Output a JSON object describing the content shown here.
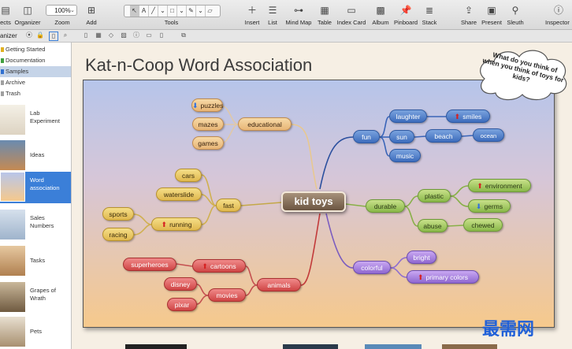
{
  "toolbar": {
    "left_cut_label": "ects",
    "organizer_label": "Organizer",
    "zoom_value": "100%",
    "zoom_label": "Zoom",
    "add_label": "Add",
    "tools_label": "Tools",
    "insert_label": "Insert",
    "list_label": "List",
    "mindmap_label": "Mind Map",
    "table_label": "Table",
    "indexcard_label": "Index Card",
    "album_label": "Album",
    "pinboard_label": "Pinboard",
    "stack_label": "Stack",
    "share_label": "Share",
    "present_label": "Present",
    "sleuth_label": "Sleuth",
    "inspector_label": "Inspector"
  },
  "subbar": {
    "organizer_tab": "anizer"
  },
  "sidebar": {
    "categories": [
      {
        "label": "Getting Started",
        "color": "#e0b020"
      },
      {
        "label": "Documentation",
        "color": "#40a040"
      },
      {
        "label": "Samples",
        "color": "#3070d0"
      },
      {
        "label": "Archive",
        "color": "#a0a0a0"
      },
      {
        "label": "Trash",
        "color": "#a0a0a0"
      }
    ],
    "documents": [
      {
        "label": "Lab Experiment"
      },
      {
        "label": "Ideas"
      },
      {
        "label": "Word association"
      },
      {
        "label": "Sales Numbers"
      },
      {
        "label": "Tasks"
      },
      {
        "label": "Grapes of Wrath"
      },
      {
        "label": "Pets"
      }
    ]
  },
  "main": {
    "title": "Kat-n-Coop Word Association",
    "cloud_text": "What do you think of when you think of toys for kids?"
  },
  "mindmap": {
    "center": "kid toys",
    "nodes": {
      "puzzles": "puzzles",
      "mazes": "mazes",
      "games": "games",
      "educational": "educational",
      "cars": "cars",
      "waterslide": "waterslide",
      "fast": "fast",
      "sports": "sports",
      "running": "running",
      "racing": "racing",
      "superheroes": "superheroes",
      "cartoons": "cartoons",
      "disney": "disney",
      "movies": "movies",
      "pixar": "pixar",
      "animals": "animals",
      "fun": "fun",
      "laughter": "laughter",
      "smiles": "smiles",
      "sun": "sun",
      "beach": "beach",
      "ocean": "ocean",
      "music": "music",
      "durable": "durable",
      "plastic": "plastic",
      "environment": "environment",
      "germs": "germs",
      "abuse": "abuse",
      "chewed": "chewed",
      "colorful": "colorful",
      "bright": "bright",
      "primary_colors": "primary colors"
    }
  },
  "watermark": "最需网"
}
